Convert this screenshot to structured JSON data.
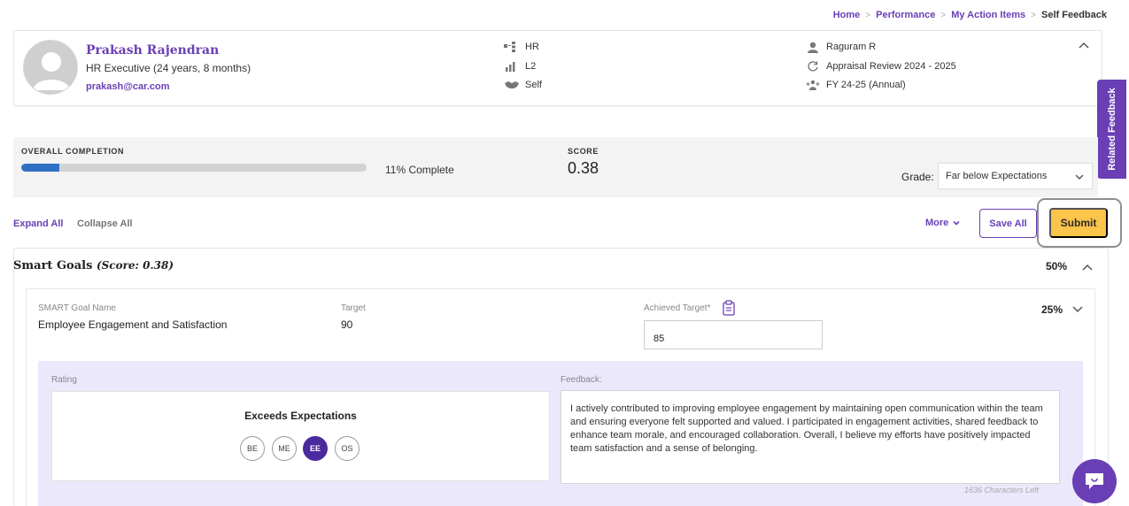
{
  "breadcrumb": {
    "home": "Home",
    "performance": "Performance",
    "action_items": "My Action Items",
    "current": "Self Feedback"
  },
  "employee": {
    "name": "Prakash Rajendran",
    "role": "HR Executive (24 years, 8 months)",
    "email": "prakash@car.com",
    "department": "HR",
    "level": "L2",
    "review_type": "Self",
    "manager": "Raguram R",
    "cycle": "Appraisal Review 2024 - 2025",
    "period": "FY 24-25 (Annual)"
  },
  "side_tab": {
    "label": "Related Feedback"
  },
  "completion": {
    "label": "OVERALL COMPLETION",
    "percent": 11,
    "percent_text": "11% Complete"
  },
  "score": {
    "label": "SCORE",
    "value": "0.38"
  },
  "grade": {
    "label": "Grade:",
    "selected": "Far below Expectations"
  },
  "actions": {
    "expand": "Expand All",
    "collapse": "Collapse All",
    "more": "More",
    "save_all": "Save All",
    "submit": "Submit"
  },
  "smart_goals": {
    "title": "Smart Goals",
    "score_text": "(Score: 0.38)",
    "weight": "50%",
    "goal": {
      "name_label": "SMART Goal Name",
      "name": "Employee Engagement and Satisfaction",
      "target_label": "Target",
      "target": "90",
      "achieved_label": "Achieved Target*",
      "achieved": "85",
      "weight": "25%",
      "rating_label": "Rating",
      "rating_name": "Exceeds Expectations",
      "rating_options": [
        "BE",
        "ME",
        "EE",
        "OS"
      ],
      "selected_rating": "EE",
      "feedback_label": "Feedback:",
      "feedback": "I actively contributed to improving employee engagement by maintaining open communication within the team and ensuring everyone felt supported and valued. I participated in engagement activities, shared feedback to enhance team morale, and encouraged collaboration. Overall, I believe my efforts have positively impacted team satisfaction and a sense of belonging.",
      "chars_left": "1636 Characters Left"
    }
  },
  "colors": {
    "brand": "#6a3fb5",
    "submit": "#fbc44a",
    "progress": "#2f6fc4",
    "rating_selected": "#4b2a9e",
    "panel_bg": "#ebe8fb"
  }
}
